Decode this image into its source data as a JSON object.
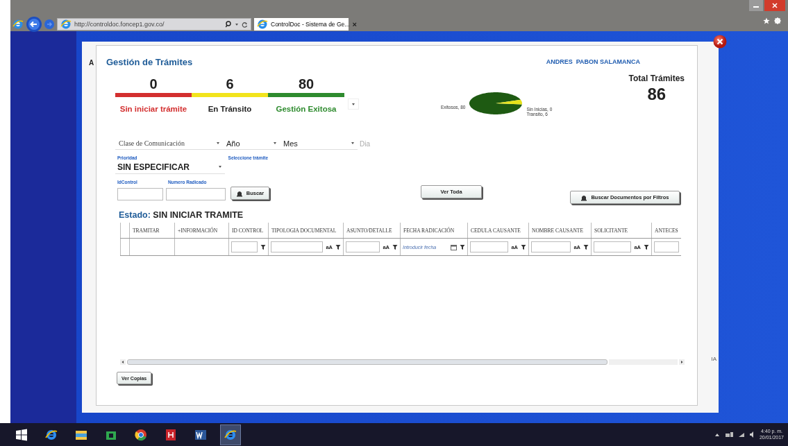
{
  "browser": {
    "address": "http://controldoc.foncep1.gov.co/",
    "tab_title": "ControlDoc - Sistema de Ge...",
    "tab_close": "×"
  },
  "background_fragments": [
    "A",
    "IA"
  ],
  "dialog": {
    "title": "Gestión de Trámites",
    "user": "ANDRES  PABON SALAMANCA"
  },
  "counters": [
    {
      "value": "0",
      "label": "Sin iniciar trámite",
      "color": "#d32f2f"
    },
    {
      "value": "6",
      "label": "En Tránsito",
      "color": "#f2e41c"
    },
    {
      "value": "80",
      "label": "Gestión Exitosa",
      "color": "#2e8b2e"
    }
  ],
  "chart_data": {
    "type": "pie",
    "categories": [
      "Exitosos, 80",
      "Sin Inicias, 0",
      "Transito, 6"
    ],
    "values": [
      80,
      0,
      6
    ],
    "colors": [
      "#1e5a12",
      "#d32f2f",
      "#e6e21a"
    ]
  },
  "total": {
    "label": "Total Trámites",
    "value": "86"
  },
  "filters": [
    {
      "kind": "select",
      "value": "Clase de Comunicación"
    },
    {
      "kind": "select",
      "value": "Año"
    },
    {
      "kind": "select",
      "value": "Mes"
    },
    {
      "kind": "placeholder",
      "value": "Dia"
    }
  ],
  "priority": {
    "label": "Prioridad",
    "value": "SIN ESPECIFICAR"
  },
  "tramite_label": "Seleccione trámite",
  "search_fields": [
    {
      "label": "IdControl"
    },
    {
      "label": "Numero Radicado"
    }
  ],
  "buttons": [
    {
      "kind": "search",
      "label": "Buscar"
    },
    {
      "kind": "plain",
      "label": "Ver Toda"
    },
    {
      "kind": "search",
      "label": "Buscar Documentos por Filtros"
    }
  ],
  "status": {
    "label": "Estado:",
    "value": "SIN INICIAR TRAMITE"
  },
  "table": {
    "columns": [
      {
        "kind": "none"
      },
      {
        "label": "TRAMITAR",
        "kind": "none"
      },
      {
        "label": "+INFORMACIÓN",
        "kind": "none"
      },
      {
        "label": "ID CONTROL",
        "kind": "number"
      },
      {
        "label": "TIPOLOGIA DOCUMENTAL",
        "kind": "text",
        "case_toggle": "aA"
      },
      {
        "label": "ASUNTO/DETALLE",
        "kind": "text",
        "case_toggle": "aA"
      },
      {
        "label": "FECHA RADICACIÓN",
        "kind": "date",
        "placeholder": "Introducir fecha"
      },
      {
        "label": "CEDULA CAUSANTE",
        "kind": "text",
        "case_toggle": "aA"
      },
      {
        "label": "NOMBRE CAUSANTE",
        "kind": "text",
        "case_toggle": "aA"
      },
      {
        "label": "SOLICITANTE",
        "kind": "text",
        "case_toggle": "aA"
      },
      {
        "label": "ANTECES",
        "kind": "input"
      }
    ]
  },
  "bottom_button": "Ver Copias",
  "taskbar": {
    "apps": [
      {
        "kind": "windows",
        "selected": false
      },
      {
        "kind": "ie",
        "selected": false
      },
      {
        "kind": "folder",
        "selected": false
      },
      {
        "kind": "store",
        "selected": false
      },
      {
        "kind": "chrome",
        "selected": false
      },
      {
        "kind": "acrobat",
        "selected": false
      },
      {
        "kind": "word",
        "selected": false
      },
      {
        "kind": "ie",
        "selected": true
      }
    ],
    "time": "4:40 p. m.",
    "date": "20/01/2017"
  }
}
